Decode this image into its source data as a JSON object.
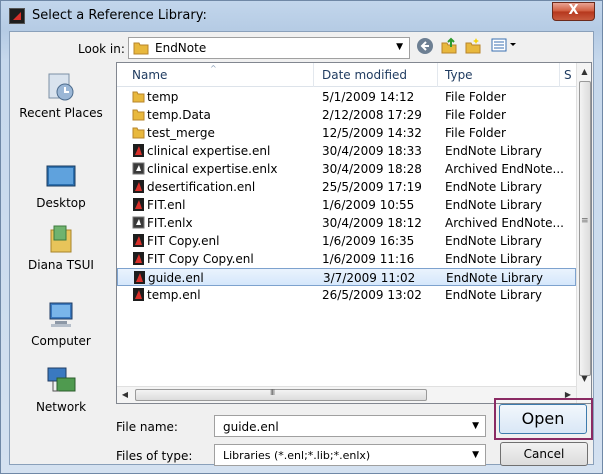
{
  "window": {
    "title": "Select a Reference Library:",
    "close_label": "X"
  },
  "toolbar": {
    "look_in_label": "Look in:",
    "look_in_value": "EndNote"
  },
  "places": [
    {
      "label": "Recent Places",
      "icon": "recent-places-icon"
    },
    {
      "label": "Desktop",
      "icon": "desktop-icon"
    },
    {
      "label": "Diana TSUI",
      "icon": "user-folder-icon"
    },
    {
      "label": "Computer",
      "icon": "computer-icon"
    },
    {
      "label": "Network",
      "icon": "network-icon"
    }
  ],
  "columns": {
    "name": "Name",
    "date": "Date modified",
    "type": "Type",
    "size": "S"
  },
  "files": [
    {
      "name": "temp",
      "date": "5/1/2009 14:12",
      "type": "File Folder",
      "icon": "folder-icon"
    },
    {
      "name": "temp.Data",
      "date": "2/12/2008 17:29",
      "type": "File Folder",
      "icon": "folder-icon"
    },
    {
      "name": "test_merge",
      "date": "12/5/2009 14:32",
      "type": "File Folder",
      "icon": "folder-icon"
    },
    {
      "name": "clinical expertise.enl",
      "date": "30/4/2009 18:33",
      "type": "EndNote Library",
      "icon": "endnote-library-icon"
    },
    {
      "name": "clinical expertise.enlx",
      "date": "30/4/2009 18:28",
      "type": "Archived EndNote...",
      "icon": "endnote-archive-icon"
    },
    {
      "name": "desertification.enl",
      "date": "25/5/2009 17:19",
      "type": "EndNote Library",
      "icon": "endnote-library-icon"
    },
    {
      "name": "FIT.enl",
      "date": "1/6/2009 10:55",
      "type": "EndNote Library",
      "icon": "endnote-library-icon"
    },
    {
      "name": "FIT.enlx",
      "date": "30/4/2009 18:12",
      "type": "Archived EndNote...",
      "icon": "endnote-archive-icon"
    },
    {
      "name": "FIT Copy.enl",
      "date": "1/6/2009 16:35",
      "type": "EndNote Library",
      "icon": "endnote-library-icon"
    },
    {
      "name": "FIT Copy Copy.enl",
      "date": "1/6/2009 11:16",
      "type": "EndNote Library",
      "icon": "endnote-library-icon"
    },
    {
      "name": "guide.enl",
      "date": "3/7/2009 11:02",
      "type": "EndNote Library",
      "icon": "endnote-library-icon",
      "selected": true
    },
    {
      "name": "temp.enl",
      "date": "26/5/2009 13:02",
      "type": "EndNote Library",
      "icon": "endnote-library-icon"
    }
  ],
  "scrollbar": {
    "h_thumb_label": "III"
  },
  "footer": {
    "file_name_label": "File name:",
    "file_name_value": "guide.enl",
    "file_type_label": "Files of type:",
    "file_type_value": "Libraries (*.enl;*.lib;*.enlx)",
    "open_label": "Open",
    "cancel_label": "Cancel"
  },
  "colors": {
    "selection": "#d5e7fb",
    "highlight_border": "#8a2a63",
    "close_button": "#c85a3e"
  }
}
